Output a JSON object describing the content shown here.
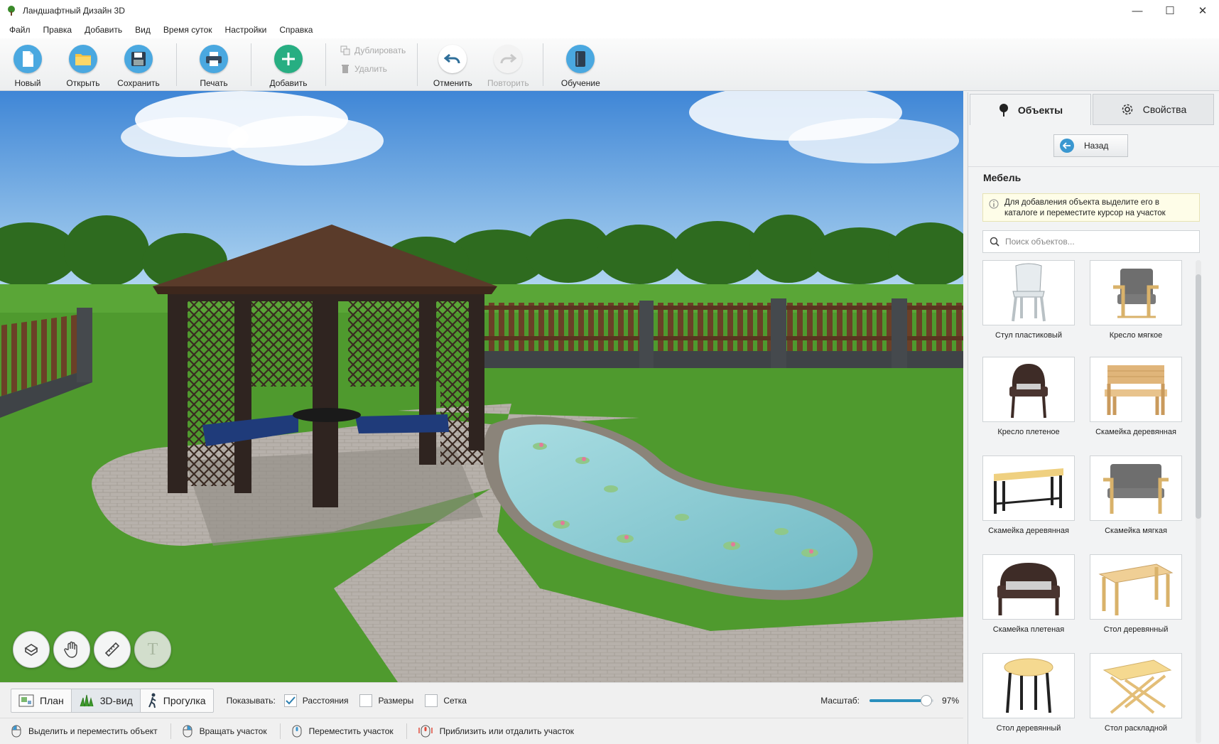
{
  "window": {
    "title": "Ландшафтный Дизайн 3D",
    "minimize": "—",
    "maximize": "☐",
    "close": "✕"
  },
  "menu": [
    "Файл",
    "Правка",
    "Добавить",
    "Вид",
    "Время суток",
    "Настройки",
    "Справка"
  ],
  "toolbar": {
    "new": "Новый",
    "open": "Открыть",
    "save": "Сохранить",
    "print": "Печать",
    "add": "Добавить",
    "duplicate": "Дублировать",
    "delete": "Удалить",
    "undo": "Отменить",
    "redo": "Повторить",
    "tutorial": "Обучение"
  },
  "view_tools": {
    "text_tool_glyph": "T"
  },
  "viewbar": {
    "modes": [
      "План",
      "3D-вид",
      "Прогулка"
    ],
    "active_mode": "3D-вид",
    "show_label": "Показывать:",
    "options": [
      {
        "label": "Расстояния",
        "checked": true
      },
      {
        "label": "Размеры",
        "checked": false
      },
      {
        "label": "Сетка",
        "checked": false
      }
    ],
    "zoom_label": "Масштаб:",
    "zoom_value": "97%",
    "zoom_fraction": 0.97
  },
  "status_hints": [
    "Выделить и переместить объект",
    "Вращать участок",
    "Переместить участок",
    "Приблизить или отдалить участок"
  ],
  "panel": {
    "tabs": [
      "Объекты",
      "Свойства"
    ],
    "back": "Назад",
    "category": "Мебель",
    "info": "Для добавления объекта выделите его в каталоге и переместите курсор на участок",
    "search_placeholder": "Поиск объектов...",
    "items": [
      "Стул пластиковый",
      "Кресло мягкое",
      "Кресло плетеное",
      "Скамейка деревянная",
      "Скамейка деревянная",
      "Скамейка мягкая",
      "Скамейка плетеная",
      "Стол деревянный",
      "Стол деревянный",
      "Стол раскладной"
    ]
  },
  "colors": {
    "accent": "#2a8fbd",
    "grass": "#4f9a2e",
    "water": "#8fcfd6",
    "roof": "#5a3b2a"
  }
}
